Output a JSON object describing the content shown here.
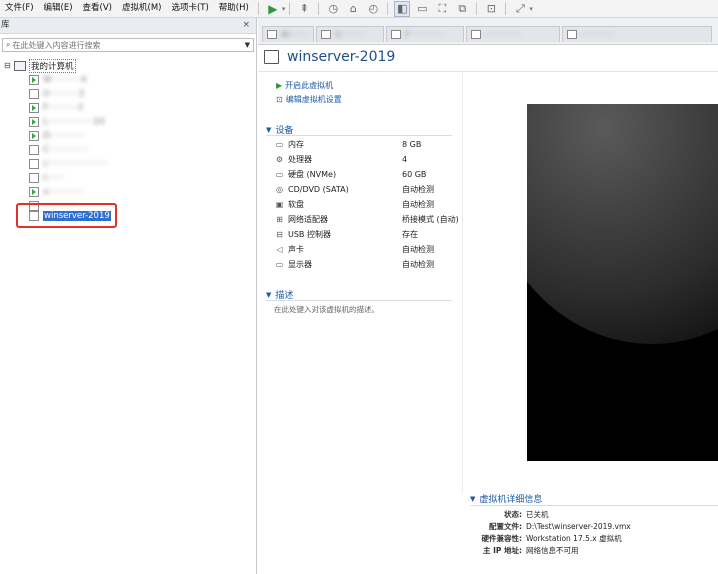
{
  "menu": [
    "文件(F)",
    "编辑(E)",
    "查看(V)",
    "虚拟机(M)",
    "选项卡(T)",
    "帮助(H)"
  ],
  "library": {
    "title": "库",
    "close": "×",
    "search_placeholder": "在此处键入内容进行搜索",
    "root": "我的计算机",
    "vms": [
      {
        "label": "W···········4",
        "state": "running"
      },
      {
        "label": "U···········2",
        "state": "stopped"
      },
      {
        "label": "F···········3",
        "state": "running"
      },
      {
        "label": "L·················24",
        "state": "running"
      },
      {
        "label": "D·············",
        "state": "running"
      },
      {
        "label": "C···············",
        "state": "stopped"
      },
      {
        "label": "c······················",
        "state": "stopped"
      },
      {
        "label": "c······",
        "state": "stopped"
      },
      {
        "label": "u·············",
        "state": "running"
      },
      {
        "label": "·············",
        "state": "stopped"
      }
    ],
    "selected_vm": "winserver-2019"
  },
  "tabs": [
    "W·······",
    "U·········",
    "F·············",
    "··············",
    "·············"
  ],
  "vm": {
    "title": "winserver-2019",
    "actions": {
      "power_on": "开启此虚拟机",
      "edit_settings": "编辑虚拟机设置"
    },
    "devices_title": "设备",
    "devices": [
      {
        "icon": "memory-icon",
        "glyph": "▭",
        "name": "内存",
        "value": "8 GB"
      },
      {
        "icon": "processor-icon",
        "glyph": "⚙",
        "name": "处理器",
        "value": "4"
      },
      {
        "icon": "hard-disk-icon",
        "glyph": "▭",
        "name": "硬盘 (NVMe)",
        "value": "60 GB"
      },
      {
        "icon": "cd-dvd-icon",
        "glyph": "◎",
        "name": "CD/DVD (SATA)",
        "value": "自动检测"
      },
      {
        "icon": "floppy-icon",
        "glyph": "▣",
        "name": "软盘",
        "value": "自动检测"
      },
      {
        "icon": "network-adapter-icon",
        "glyph": "⊞",
        "name": "网络适配器",
        "value": "桥接模式 (自动)"
      },
      {
        "icon": "usb-controller-icon",
        "glyph": "⊟",
        "name": "USB 控制器",
        "value": "存在"
      },
      {
        "icon": "sound-card-icon",
        "glyph": "◁",
        "name": "声卡",
        "value": "自动检测"
      },
      {
        "icon": "display-icon",
        "glyph": "▭",
        "name": "显示器",
        "value": "自动检测"
      }
    ],
    "description_title": "描述",
    "description_placeholder": "在此处键入对该虚拟机的描述。",
    "details_title": "虚拟机详细信息",
    "details": [
      {
        "key": "状态:",
        "value": "已关机"
      },
      {
        "key": "配置文件:",
        "value": "D:\\Test\\winserver-2019.vmx"
      },
      {
        "key": "硬件兼容性:",
        "value": "Workstation 17.5.x 虚拟机"
      },
      {
        "key": "主 IP 地址:",
        "value": "网络信息不可用"
      }
    ]
  }
}
